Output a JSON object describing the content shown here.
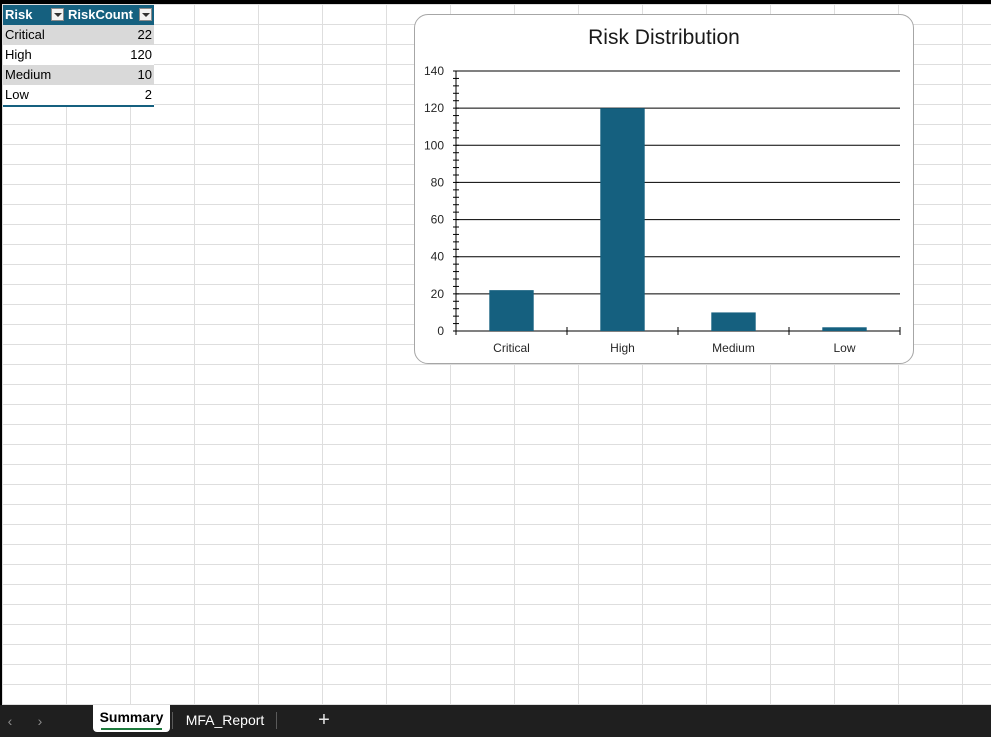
{
  "table": {
    "headers": [
      "Risk",
      "RiskCount"
    ],
    "rows": [
      {
        "risk": "Critical",
        "count": "22"
      },
      {
        "risk": "High",
        "count": "120"
      },
      {
        "risk": "Medium",
        "count": "10"
      },
      {
        "risk": "Low",
        "count": "2"
      }
    ]
  },
  "chart_data": {
    "type": "bar",
    "title": "Risk Distribution",
    "categories": [
      "Critical",
      "High",
      "Medium",
      "Low"
    ],
    "values": [
      22,
      120,
      10,
      2
    ],
    "ylim": [
      0,
      140
    ],
    "yticks": [
      0,
      20,
      40,
      60,
      80,
      100,
      120,
      140
    ],
    "grid": true,
    "bar_color": "#15607f"
  },
  "sheet_tabs": {
    "prev_arrow": "‹",
    "next_arrow": "›",
    "tabs": [
      {
        "label": "Summary",
        "active": true
      },
      {
        "label": "MFA_Report",
        "active": false
      }
    ],
    "add_label": "+"
  },
  "colors": {
    "table_header": "#15607f",
    "bar": "#15607f",
    "active_tab_underline": "#1c7a3c"
  }
}
